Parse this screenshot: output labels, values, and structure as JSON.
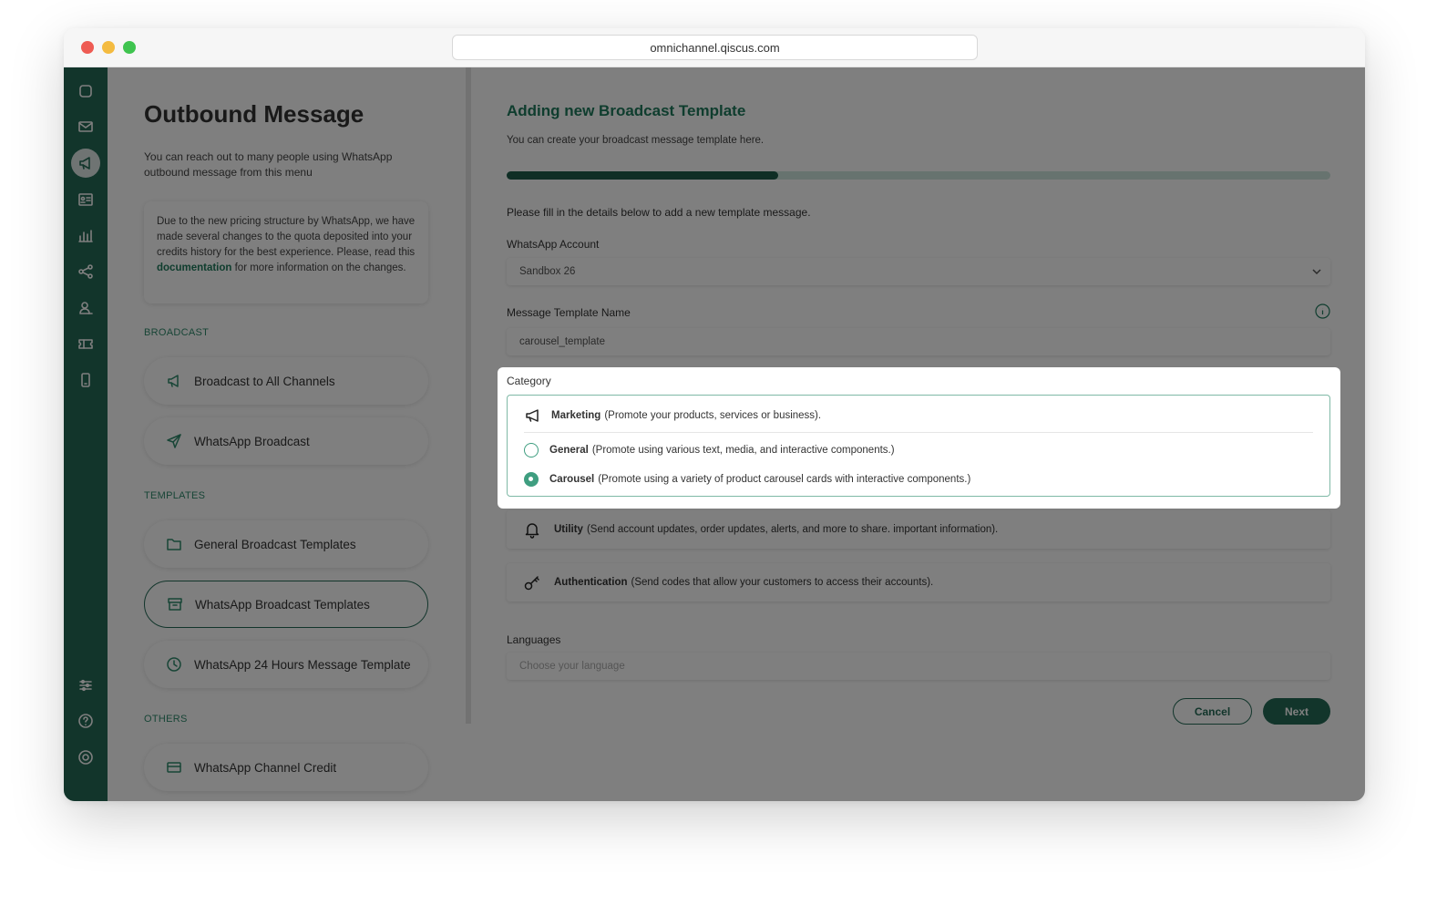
{
  "browser": {
    "url": "omnichannel.qiscus.com"
  },
  "rail": {
    "icons": [
      "chat-icon",
      "inbox-icon",
      "megaphone-icon",
      "contacts-icon",
      "analytics-icon",
      "integration-icon",
      "agent-icon",
      "ticket-icon",
      "mobile-icon",
      "settings-icon",
      "help-icon",
      "support-icon"
    ]
  },
  "left": {
    "title": "Outbound Message",
    "intro": "You can reach out to many people using WhatsApp outbound message from this menu",
    "notice_before": "Due to the new pricing structure by WhatsApp, we have made several changes to the quota deposited into your credits history for the best experience. Please, read this ",
    "notice_link": "documentation",
    "notice_after": " for more information on the changes.",
    "sections": {
      "broadcast": "BROADCAST",
      "templates": "TEMPLATES",
      "others": "OTHERS"
    },
    "nav": {
      "broadcast_all": "Broadcast to All Channels",
      "wa_broadcast": "WhatsApp Broadcast",
      "general_templates": "General Broadcast Templates",
      "wa_templates": "WhatsApp Broadcast Templates",
      "wa_24h": "WhatsApp 24 Hours Message Template",
      "wa_credit": "WhatsApp Channel Credit"
    }
  },
  "form": {
    "title": "Adding new Broadcast Template",
    "subtitle": "You can create your broadcast message template here.",
    "progress": 0.33,
    "instructions": "Please fill in the details below to add a new template message.",
    "account_label": "WhatsApp Account",
    "account_value": "Sandbox 26",
    "name_label": "Message Template Name",
    "name_value": "carousel_template",
    "category_label": "Category",
    "categories": {
      "marketing": {
        "name": "Marketing",
        "desc": "(Promote your products, services or business)."
      },
      "general": {
        "name": "General",
        "desc": "(Promote using various text, media, and interactive components.)"
      },
      "carousel": {
        "name": "Carousel",
        "desc": "(Promote using a variety of product carousel cards with interactive components.)"
      },
      "utility": {
        "name": "Utility",
        "desc": "(Send account updates, order updates, alerts, and more to share. important information)."
      },
      "authentication": {
        "name": "Authentication",
        "desc": "(Send codes that allow your customers to access their accounts)."
      }
    },
    "selected_option": "carousel",
    "languages_label": "Languages",
    "languages_placeholder": "Choose your language",
    "cancel": "Cancel",
    "next": "Next"
  },
  "colors": {
    "brand": "#246b57",
    "accent": "#1e7a5c",
    "radio": "#3f9e80"
  }
}
